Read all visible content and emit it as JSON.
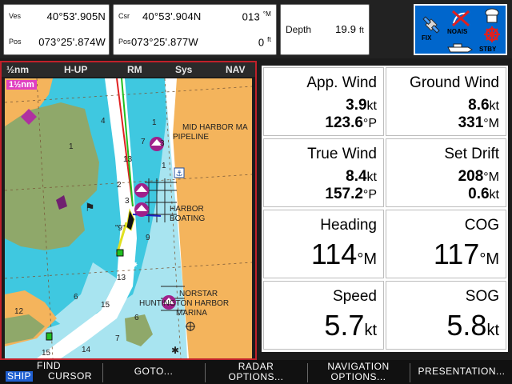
{
  "status": {
    "vessel": {
      "label_ves": "Ves",
      "lat": "40°53'.905N",
      "label_pos": "Pos",
      "lon": "073°25'.874W"
    },
    "cursor": {
      "label_csr": "Csr",
      "lat": "40°53'.904N",
      "label_pos": "Pos",
      "lon": "073°25'.877W",
      "bearing": "013",
      "bearing_unit": "°M",
      "range": "0",
      "range_unit": "ft"
    },
    "depth": {
      "label": "Depth",
      "value": "19.9",
      "unit": "ft"
    },
    "icons": {
      "fix": "FIX",
      "noaa": "NOAIS",
      "stby": "STBY"
    }
  },
  "chart": {
    "header": {
      "range": "½nm",
      "orientation": "H-UP",
      "motion": "RM",
      "sys": "Sys",
      "nav": "NAV"
    },
    "range_badge": "1½nm",
    "labels": {
      "pipeline": "PIPELINE",
      "mid_harbor": "MID HARBOR MA",
      "harbor": "HARBOR",
      "boating": "BOATING",
      "northstar": "NORSTAR",
      "marina": "MARINA",
      "huntington": "HUNTINGTON HARBOR",
      "buoy9": "\"9\""
    },
    "soundings": [
      "4",
      "1",
      "7",
      "1",
      "3",
      "13",
      "1",
      "2",
      "3",
      "9",
      "13",
      "6",
      "15",
      "12",
      "6",
      "7",
      "14",
      "15"
    ]
  },
  "data": {
    "app_wind": {
      "label": "App. Wind",
      "speed": "3.9",
      "speed_unit": "kt",
      "angle": "123.6",
      "angle_unit": "°P"
    },
    "ground_wind": {
      "label": "Ground Wind",
      "speed": "8.6",
      "speed_unit": "kt",
      "angle": "331",
      "angle_unit": "°M"
    },
    "true_wind": {
      "label": "True Wind",
      "speed": "8.4",
      "speed_unit": "kt",
      "angle": "157.2",
      "angle_unit": "°P"
    },
    "set_drift": {
      "label": "Set Drift",
      "set": "208",
      "set_unit": "°M",
      "drift": "0.6",
      "drift_unit": "kt"
    },
    "heading": {
      "label": "Heading",
      "value": "114",
      "unit": "°M"
    },
    "cog": {
      "label": "COG",
      "value": "117",
      "unit": "°M"
    },
    "speed": {
      "label": "Speed",
      "value": "5.7",
      "unit": "kt"
    },
    "sog": {
      "label": "SOG",
      "value": "5.8",
      "unit": "kt"
    }
  },
  "softkeys": {
    "ship": "SHIP",
    "find_line1": "FIND",
    "find_line2": "CURSOR",
    "goto": "GOTO...",
    "radar_line1": "RADAR",
    "radar_line2": "OPTIONS...",
    "nav_line1": "NAVIGATION",
    "nav_line2": "OPTIONS...",
    "presentation": "PRESENTATION..."
  },
  "colors": {
    "land": "#f4b45c",
    "shallow": "#3fc8e0",
    "mid_water": "#a8e4f0",
    "deep": "#ffffff",
    "marsh": "#8fa86a",
    "panel_border": "#c0202a",
    "icon_panel": "#0066cc",
    "range_badge": "#e040c0"
  }
}
